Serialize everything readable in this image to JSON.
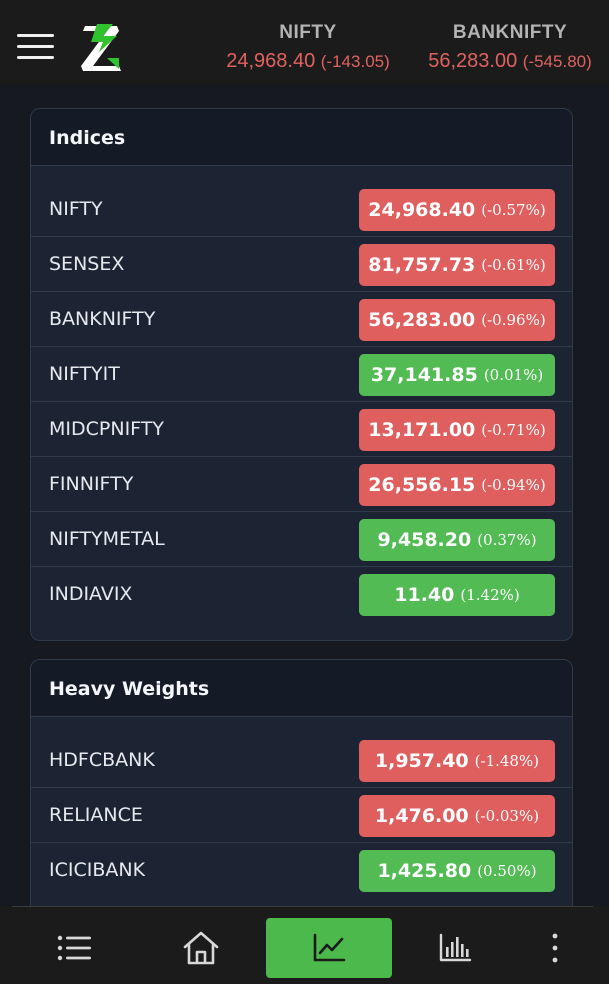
{
  "header": {
    "logo_letter": "Z",
    "tickers": [
      {
        "name": "NIFTY",
        "value": "24,968.40",
        "change": "(-143.05)"
      },
      {
        "name": "BANKNIFTY",
        "value": "56,283.00",
        "change": "(-545.80)"
      }
    ]
  },
  "indices": {
    "title": "Indices",
    "rows": [
      {
        "symbol": "NIFTY",
        "price": "24,968.40",
        "pct": "(-0.57%)",
        "trend": "down"
      },
      {
        "symbol": "SENSEX",
        "price": "81,757.73",
        "pct": "(-0.61%)",
        "trend": "down"
      },
      {
        "symbol": "BANKNIFTY",
        "price": "56,283.00",
        "pct": "(-0.96%)",
        "trend": "down"
      },
      {
        "symbol": "NIFTYIT",
        "price": "37,141.85",
        "pct": "(0.01%)",
        "trend": "up"
      },
      {
        "symbol": "MIDCPNIFTY",
        "price": "13,171.00",
        "pct": "(-0.71%)",
        "trend": "down"
      },
      {
        "symbol": "FINNIFTY",
        "price": "26,556.15",
        "pct": "(-0.94%)",
        "trend": "down"
      },
      {
        "symbol": "NIFTYMETAL",
        "price": "9,458.20",
        "pct": "(0.37%)",
        "trend": "up"
      },
      {
        "symbol": "INDIAVIX",
        "price": "11.40",
        "pct": "(1.42%)",
        "trend": "up"
      }
    ]
  },
  "heavy_weights": {
    "title": "Heavy Weights",
    "rows": [
      {
        "symbol": "HDFCBANK",
        "price": "1,957.40",
        "pct": "(-1.48%)",
        "trend": "down"
      },
      {
        "symbol": "RELIANCE",
        "price": "1,476.00",
        "pct": "(-0.03%)",
        "trend": "down"
      },
      {
        "symbol": "ICICIBANK",
        "price": "1,425.80",
        "pct": "(0.50%)",
        "trend": "up"
      }
    ]
  },
  "bottom_nav": {
    "items": [
      {
        "icon": "list-icon",
        "active": false
      },
      {
        "icon": "home-icon",
        "active": false
      },
      {
        "icon": "line-chart-icon",
        "active": true
      },
      {
        "icon": "bar-chart-icon",
        "active": false
      },
      {
        "icon": "more-vertical-icon",
        "active": false
      }
    ]
  },
  "colors": {
    "down": "#df5e5e",
    "up": "#52bb53",
    "accent": "#4cb94d",
    "ticker_negative": "#e0625f"
  }
}
